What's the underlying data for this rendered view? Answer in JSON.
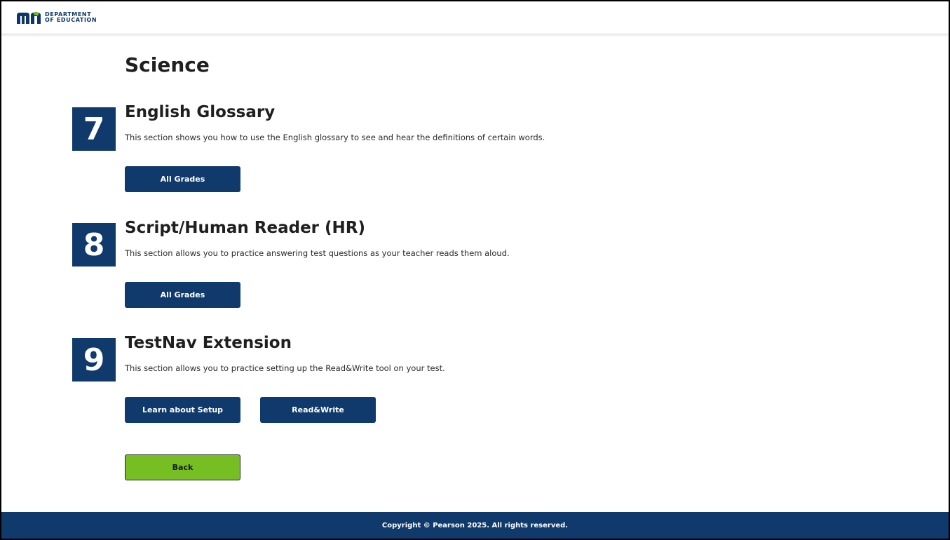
{
  "header": {
    "logo_line1": "DEPARTMENT",
    "logo_line2": "OF EDUCATION"
  },
  "page": {
    "title": "Science"
  },
  "sections": [
    {
      "number": "7",
      "title": "English Glossary",
      "description": "This section shows you how to use the English glossary to see and hear the definitions of certain words.",
      "buttons": [
        "All Grades"
      ]
    },
    {
      "number": "8",
      "title": "Script/Human Reader (HR)",
      "description": "This section allows you to practice answering test questions as your teacher reads them aloud.",
      "buttons": [
        "All Grades"
      ]
    },
    {
      "number": "9",
      "title": "TestNav Extension",
      "description": "This section allows you to practice setting up the Read&Write tool on your test.",
      "buttons": [
        "Learn about Setup",
        "Read&Write"
      ]
    }
  ],
  "back_label": "Back",
  "footer": {
    "copyright": "Copyright © Pearson 2025. All rights reserved."
  },
  "colors": {
    "navy": "#0f3a6b",
    "back_green": "#76be21",
    "logo_green": "#78be20"
  }
}
